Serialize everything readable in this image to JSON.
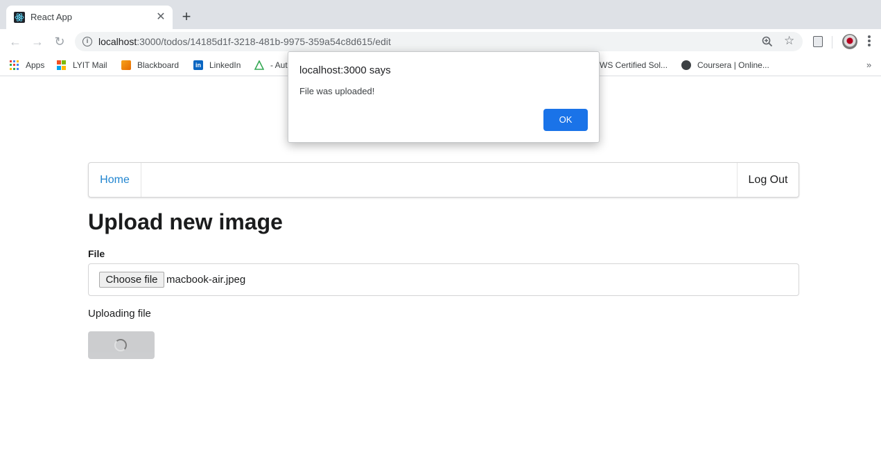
{
  "browser": {
    "tab": {
      "title": "React App",
      "favicon": "react-icon",
      "close": "✕"
    },
    "new_tab": "+",
    "url": {
      "host": "localhost",
      "rest": ":3000/todos/14185d1f-3218-481b-9975-359a54c8d615/edit"
    },
    "bookmarks": [
      {
        "label": "Apps",
        "icon": "apps-grid-icon"
      },
      {
        "label": "LYIT Mail",
        "icon": "microsoft-icon"
      },
      {
        "label": "Blackboard",
        "icon": "blackboard-icon"
      },
      {
        "label": "LinkedIn",
        "icon": "linkedin-icon"
      },
      {
        "label": "- Aut",
        "icon": "triangle-icon"
      },
      {
        "label": "WS Certified Sol...",
        "icon": ""
      },
      {
        "label": "Coursera | Online...",
        "icon": "globe-icon"
      }
    ],
    "more_bookmarks": "»"
  },
  "page": {
    "nav": {
      "home": "Home",
      "logout": "Log Out"
    },
    "title": "Upload new image",
    "file_label": "File",
    "choose_file": "Choose file",
    "file_name": "macbook-air.jpeg",
    "status": "Uploading file"
  },
  "dialog": {
    "title": "localhost:3000 says",
    "message": "File was uploaded!",
    "ok": "OK"
  },
  "colors": {
    "link": "#2185d0",
    "dialog_button": "#1a73e8",
    "tab_strip": "#dee1e6"
  }
}
